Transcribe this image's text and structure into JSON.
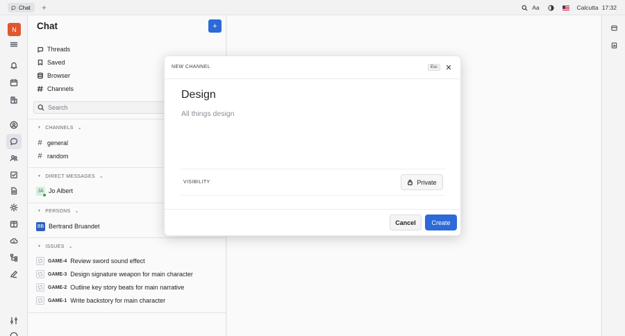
{
  "topbar": {
    "tab_label": "Chat",
    "add_tab_symbol": "+",
    "font_size_label": "Aa",
    "location": "Calcutta",
    "time": "17:32"
  },
  "workspace": {
    "avatar_letter": "N",
    "avatar_color": "#e0562f"
  },
  "panel": {
    "title": "Chat",
    "new_button_symbol": "+",
    "nav": [
      "Threads",
      "Saved",
      "Browser",
      "Channels"
    ],
    "search_placeholder": "Search"
  },
  "sections": {
    "channels": {
      "label": "CHANNELS",
      "items": [
        "general",
        "random"
      ]
    },
    "direct_messages": {
      "label": "DIRECT MESSAGES",
      "items": [
        {
          "initials": "JA",
          "name": "Jo Albert"
        }
      ]
    },
    "persons": {
      "label": "PERSONS",
      "items": [
        {
          "initials": "BB",
          "name": "Bertrand Bruandet"
        }
      ]
    },
    "issues": {
      "label": "ISSUES",
      "items": [
        {
          "id": "GAME-4",
          "title": "Review sword sound effect"
        },
        {
          "id": "GAME-3",
          "title": "Design signature weapon for main character"
        },
        {
          "id": "GAME-2",
          "title": "Outline key story beats for main narrative"
        },
        {
          "id": "GAME-1",
          "title": "Write backstory for main character"
        }
      ]
    }
  },
  "modal": {
    "label": "NEW CHANNEL",
    "esc": "Esc",
    "close_symbol": "✕",
    "name_value": "Design",
    "description_value": "All things design",
    "visibility_label": "VISIBILITY",
    "visibility_value": "Private",
    "cancel_label": "Cancel",
    "create_label": "Create"
  },
  "colors": {
    "accent": "#2d6ad8",
    "online": "#2ea44f"
  }
}
